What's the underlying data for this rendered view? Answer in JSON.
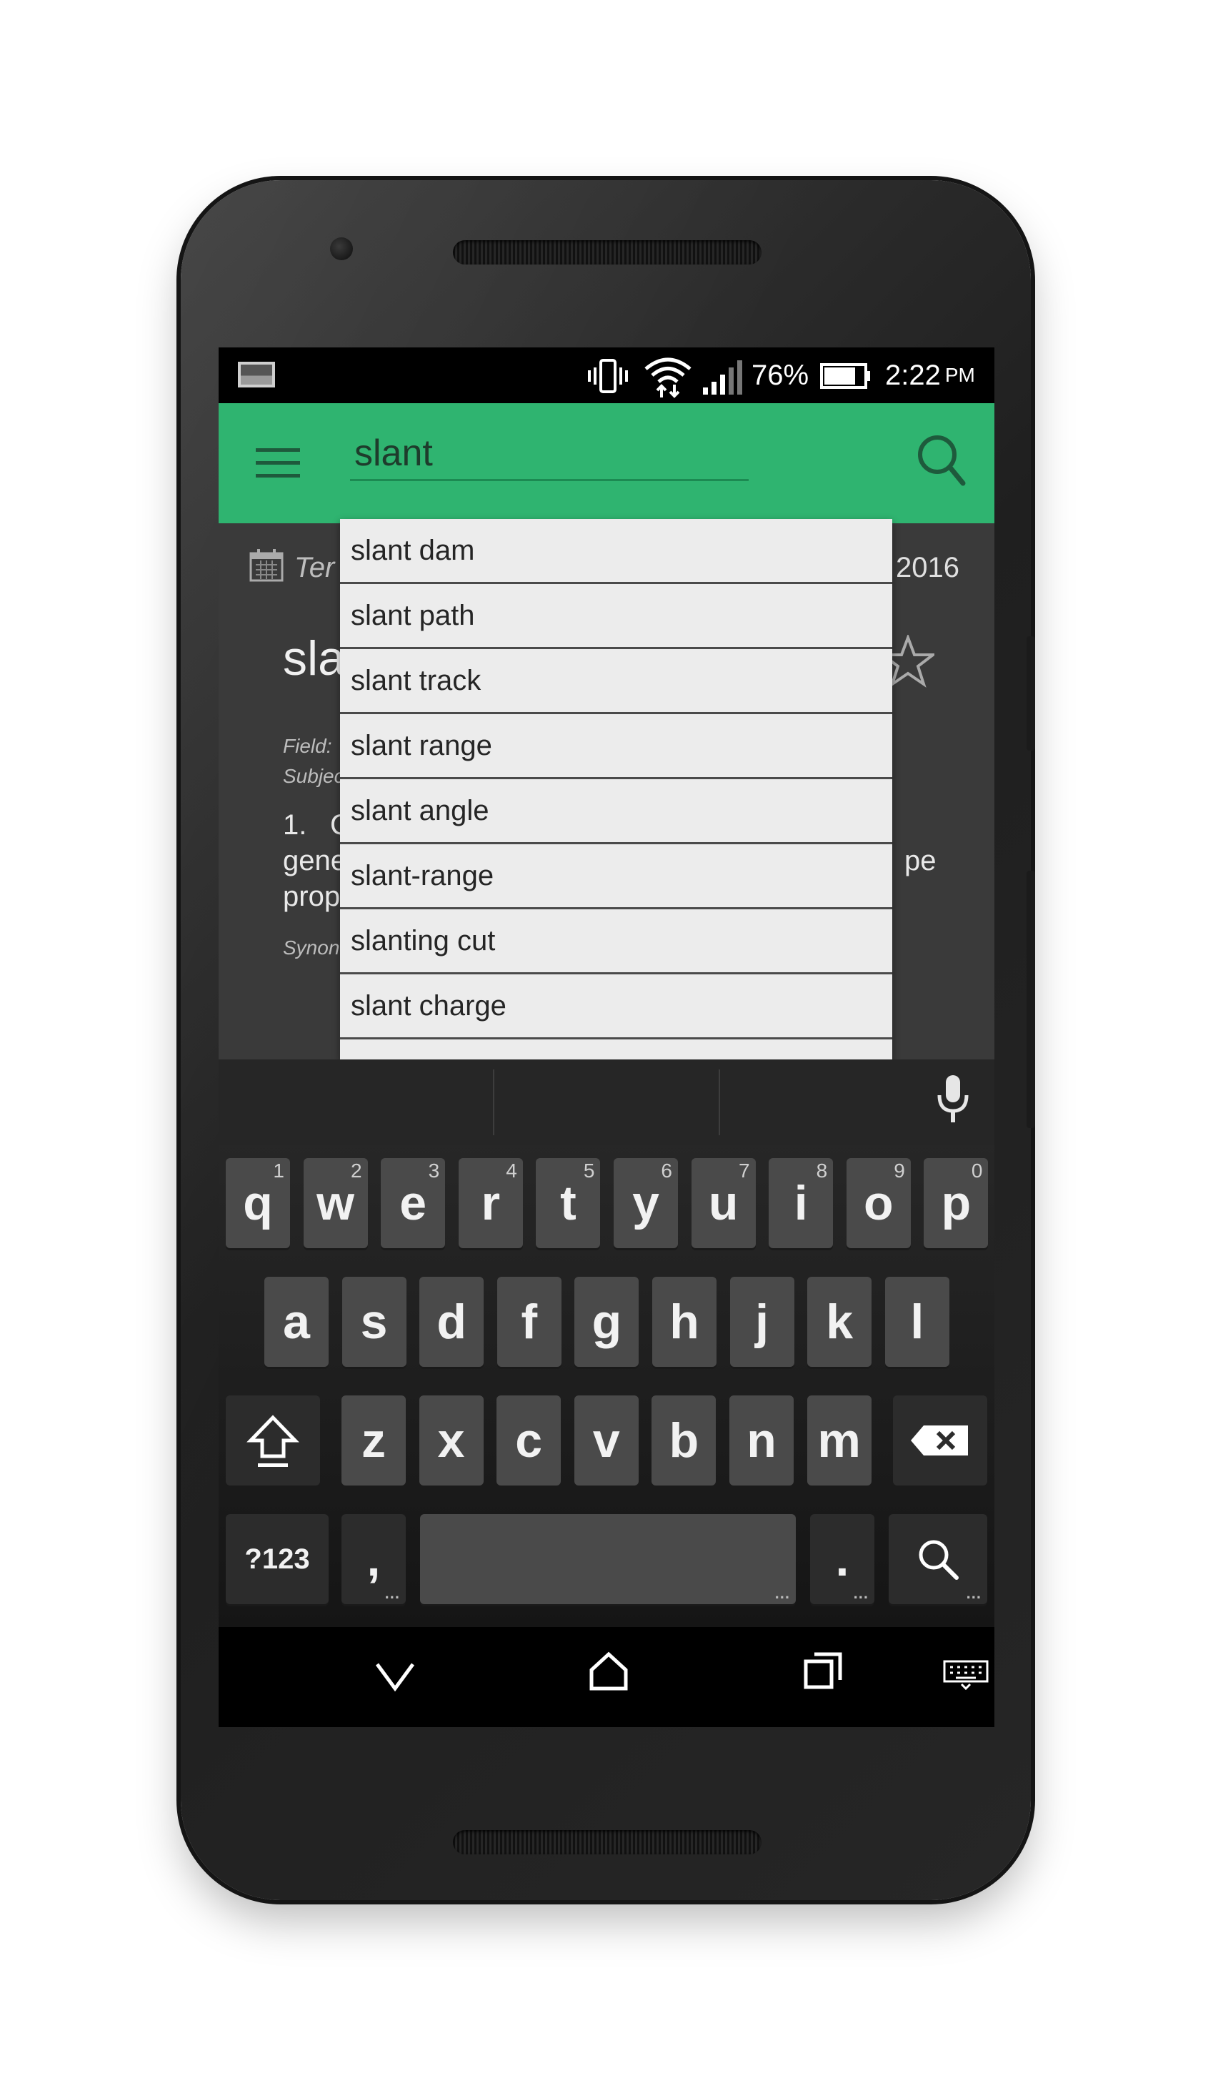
{
  "status_bar": {
    "battery_percent": "76%",
    "battery_level": 0.76,
    "time": "2:22",
    "time_suffix": "PM",
    "icons": [
      "image-icon",
      "vibrate-icon",
      "wifi-icon",
      "signal-icon",
      "battery-icon"
    ]
  },
  "app_bar": {
    "search_value": "slant",
    "color": "#2fb470",
    "icons": [
      "menu-icon",
      "search-icon"
    ]
  },
  "content": {
    "header_prefix": "Ter",
    "header_year": "2016",
    "term_partial": "sla",
    "field_label": "Field:",
    "subject_label": "Subjec",
    "definition_number": "1.",
    "definition_letter": "C",
    "line2_start": "gene",
    "line2_end": "pe",
    "line3_start": "prop",
    "synonyms_label": "Synon"
  },
  "dropdown": {
    "items": [
      "slant dam",
      "slant path",
      "slant track",
      "slant range",
      "slant angle",
      "slant-range",
      "slanting cut",
      "slant charge"
    ]
  },
  "keyboard": {
    "row1": [
      {
        "label": "q",
        "hint": "1"
      },
      {
        "label": "w",
        "hint": "2"
      },
      {
        "label": "e",
        "hint": "3"
      },
      {
        "label": "r",
        "hint": "4"
      },
      {
        "label": "t",
        "hint": "5"
      },
      {
        "label": "y",
        "hint": "6"
      },
      {
        "label": "u",
        "hint": "7"
      },
      {
        "label": "i",
        "hint": "8"
      },
      {
        "label": "o",
        "hint": "9"
      },
      {
        "label": "p",
        "hint": "0"
      }
    ],
    "row2": [
      "a",
      "s",
      "d",
      "f",
      "g",
      "h",
      "j",
      "k",
      "l"
    ],
    "row3": [
      "z",
      "x",
      "c",
      "v",
      "b",
      "n",
      "m"
    ],
    "symbols_label": "?123",
    "comma_label": ",",
    "period_label": ".",
    "more_dots": "..."
  },
  "navbar": {
    "icons": [
      "back-icon",
      "home-icon",
      "recents-icon",
      "keyboard-icon"
    ]
  }
}
